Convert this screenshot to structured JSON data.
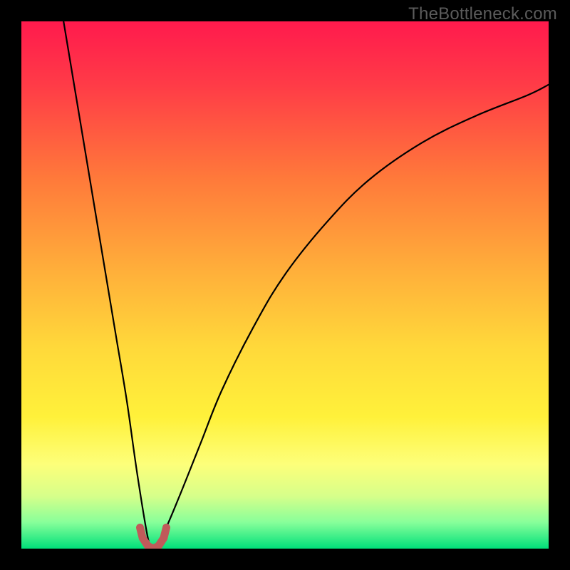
{
  "watermark": "TheBottleneck.com",
  "gradient": {
    "stops": [
      {
        "offset": 0.0,
        "color": "#ff1a4d"
      },
      {
        "offset": 0.12,
        "color": "#ff3b47"
      },
      {
        "offset": 0.3,
        "color": "#ff7a3a"
      },
      {
        "offset": 0.48,
        "color": "#ffb13a"
      },
      {
        "offset": 0.62,
        "color": "#ffd93a"
      },
      {
        "offset": 0.75,
        "color": "#fff13a"
      },
      {
        "offset": 0.84,
        "color": "#fdff7a"
      },
      {
        "offset": 0.9,
        "color": "#d7ff8a"
      },
      {
        "offset": 0.95,
        "color": "#88ff9a"
      },
      {
        "offset": 1.0,
        "color": "#00e07a"
      }
    ]
  },
  "chart_data": {
    "type": "line",
    "title": "",
    "xlabel": "",
    "ylabel": "",
    "xlim": [
      0,
      100
    ],
    "ylim": [
      0,
      100
    ],
    "notch_x": 25,
    "series": [
      {
        "name": "left-branch",
        "x": [
          8,
          10,
          12,
          14,
          16,
          18,
          20,
          22,
          24,
          25
        ],
        "values": [
          100,
          88,
          76,
          64,
          52,
          40,
          28,
          14,
          2,
          0
        ]
      },
      {
        "name": "right-branch",
        "x": [
          25,
          27,
          30,
          34,
          38,
          44,
          50,
          58,
          66,
          76,
          86,
          96,
          100
        ],
        "values": [
          0,
          3,
          10,
          20,
          30,
          42,
          52,
          62,
          70,
          77,
          82,
          86,
          88
        ]
      }
    ],
    "marker_path": {
      "name": "notch-marker",
      "color": "#c05a5a",
      "width": 11,
      "points_xy": [
        [
          22.5,
          4.0
        ],
        [
          23.0,
          2.0
        ],
        [
          24.0,
          0.5
        ],
        [
          25.0,
          0.0
        ],
        [
          26.0,
          0.5
        ],
        [
          27.0,
          2.0
        ],
        [
          27.5,
          4.0
        ]
      ]
    }
  }
}
